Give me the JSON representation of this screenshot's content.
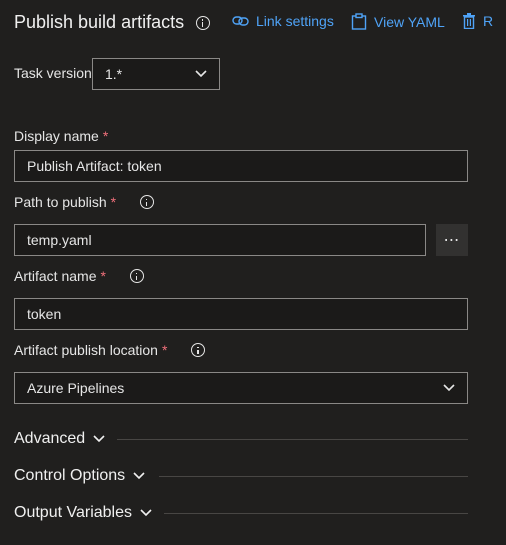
{
  "header": {
    "title": "Publish build artifacts",
    "link_settings": "Link settings",
    "view_yaml": "View YAML",
    "remove": "R"
  },
  "task_version": {
    "label": "Task version",
    "value": "1.*"
  },
  "display_name": {
    "label": "Display name",
    "required": "*",
    "value": "Publish Artifact: token"
  },
  "path_to_publish": {
    "label": "Path to publish",
    "required": "*",
    "value": "temp.yaml",
    "browse_label": "⋯"
  },
  "artifact_name": {
    "label": "Artifact name",
    "required": "*",
    "value": "token"
  },
  "publish_location": {
    "label": "Artifact publish location",
    "required": "*",
    "value": "Azure Pipelines"
  },
  "sections": {
    "advanced": "Advanced",
    "control_options": "Control Options",
    "output_variables": "Output Variables"
  },
  "colors": {
    "background": "#201f1e",
    "accent": "#4fa3f7",
    "required": "#f1707b",
    "border": "#8a8886"
  }
}
